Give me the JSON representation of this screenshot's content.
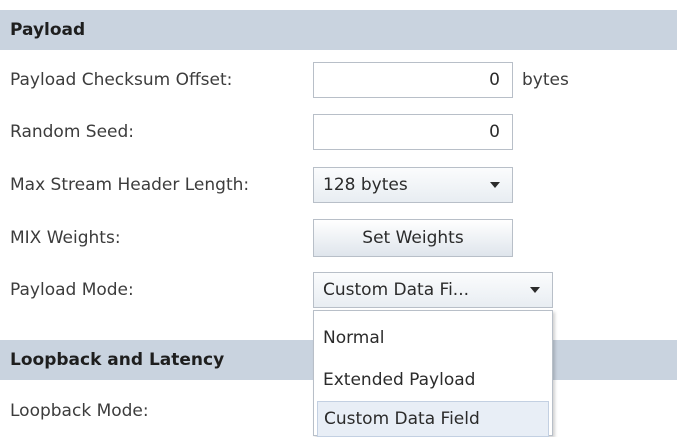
{
  "sections": {
    "payload": "Payload",
    "loopback": "Loopback and Latency"
  },
  "fields": {
    "checksum_offset": {
      "label": "Payload Checksum Offset:",
      "value": "0",
      "units": "bytes"
    },
    "random_seed": {
      "label": "Random Seed:",
      "value": "0"
    },
    "max_stream_header": {
      "label": "Max Stream Header Length:",
      "selected": "128 bytes"
    },
    "mix_weights": {
      "label": "MIX Weights:",
      "button": "Set Weights"
    },
    "payload_mode": {
      "label": "Payload Mode:",
      "selected": "Custom Data Fi...",
      "options": [
        "Normal",
        "Extended Payload",
        "Custom Data Field"
      ]
    },
    "loopback_mode": {
      "label": "Loopback Mode:"
    }
  },
  "colors": {
    "section_header_bg": "#c9d3df",
    "selected_item_bg": "#e8eef6"
  }
}
